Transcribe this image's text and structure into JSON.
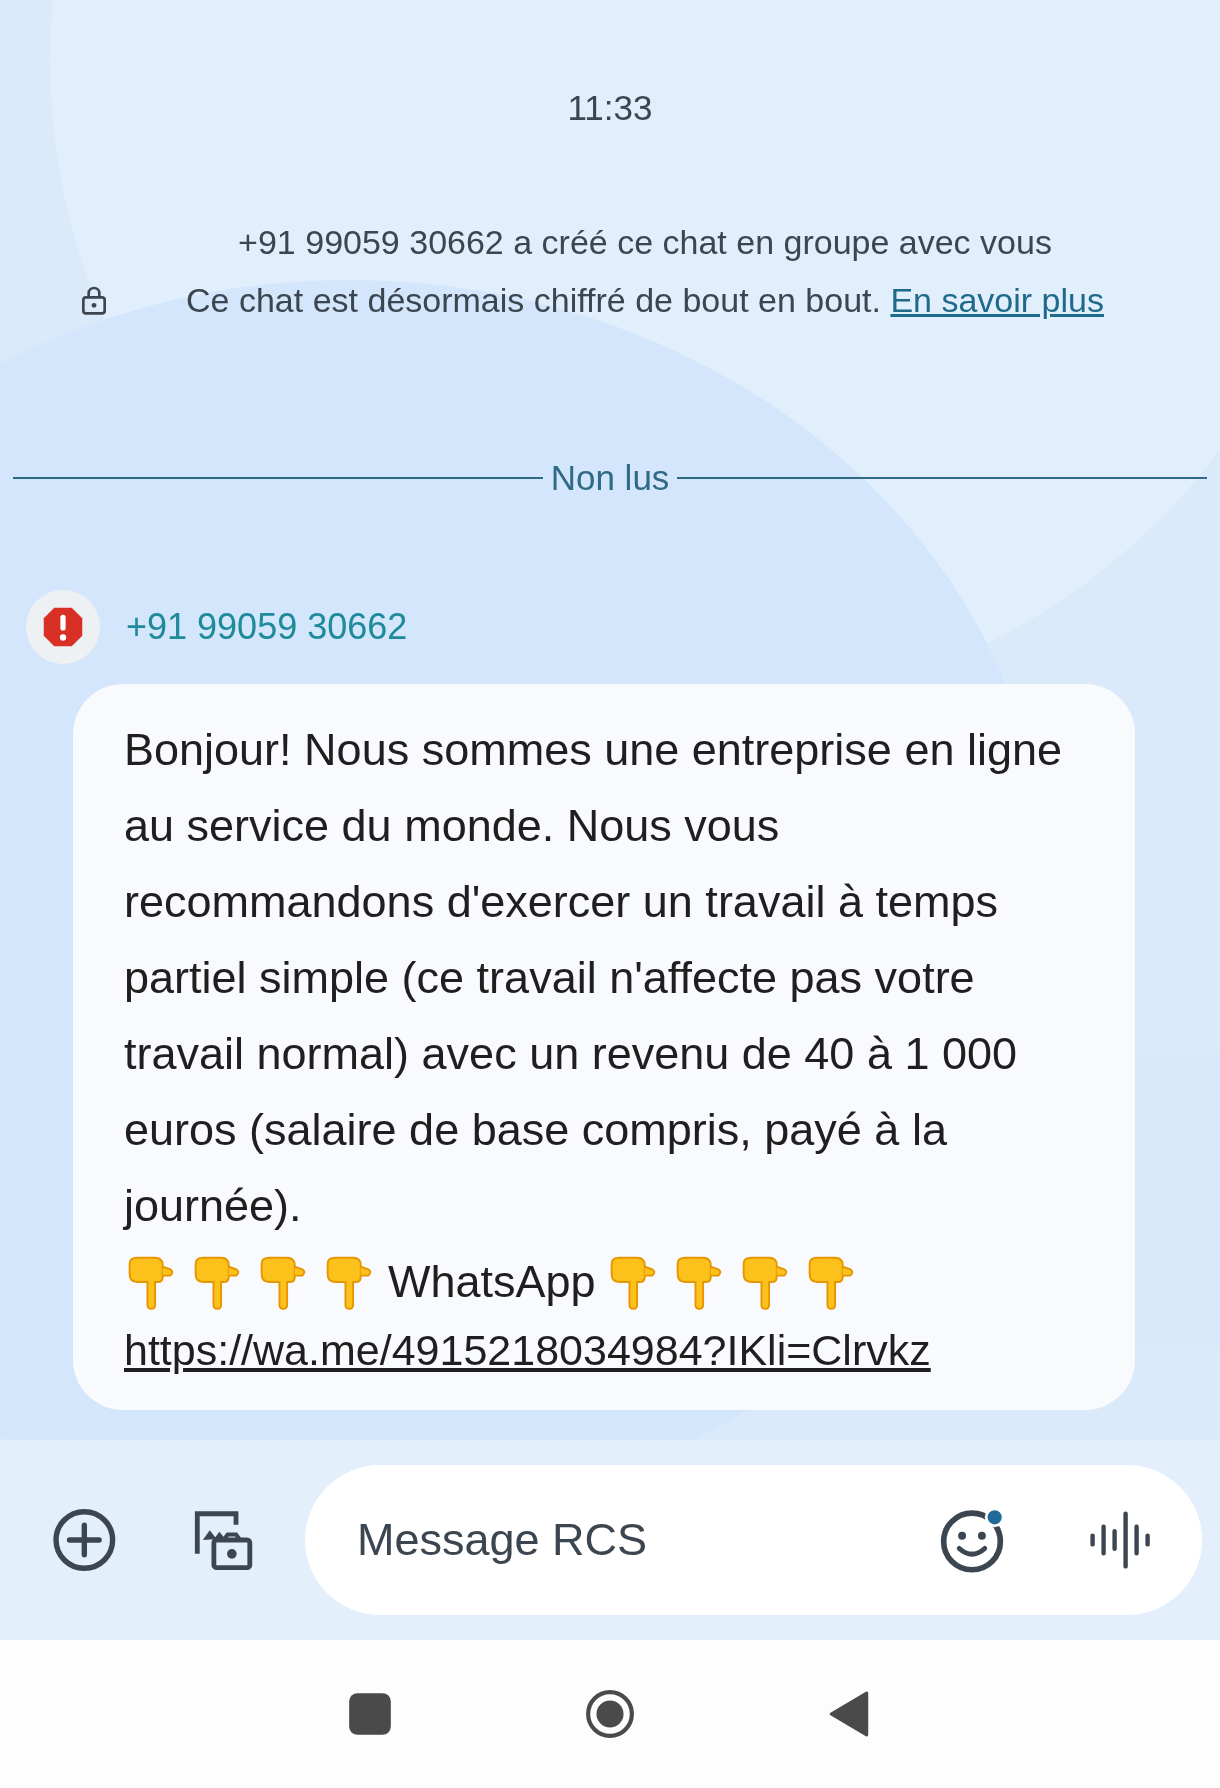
{
  "time": "11:33",
  "system_messages": [
    {
      "text": "+91 99059 30662 a créé ce chat en groupe avec vous"
    },
    {
      "text": "Ce chat est désormais chiffré de bout en bout.",
      "link": "En savoir plus",
      "locked": true
    }
  ],
  "divider": {
    "label": "Non lus"
  },
  "message": {
    "sender": "+91 99059 30662",
    "alert": true,
    "text": "Bonjour! Nous sommes une entreprise en ligne au service du monde. Nous vous recommandons d'exercer un travail à temps partiel simple (ce travail n'affecte pas votre travail normal) avec un revenu de 40 à 1 000 euros (salaire de base compris, payé à la journée).",
    "emoji_line": [
      {
        "kind": "pointing-hand"
      },
      {
        "kind": "pointing-hand"
      },
      {
        "kind": "pointing-hand"
      },
      {
        "kind": "pointing-hand"
      },
      {
        "kind": "text",
        "text": "WhatsApp"
      },
      {
        "kind": "pointing-hand"
      },
      {
        "kind": "pointing-hand"
      },
      {
        "kind": "pointing-hand"
      },
      {
        "kind": "pointing-hand"
      }
    ],
    "link": "https://wa.me/4915218034984?IKli=Clrvkz"
  },
  "composer": {
    "placeholder": "Message RCS",
    "emoji_badge": true
  }
}
